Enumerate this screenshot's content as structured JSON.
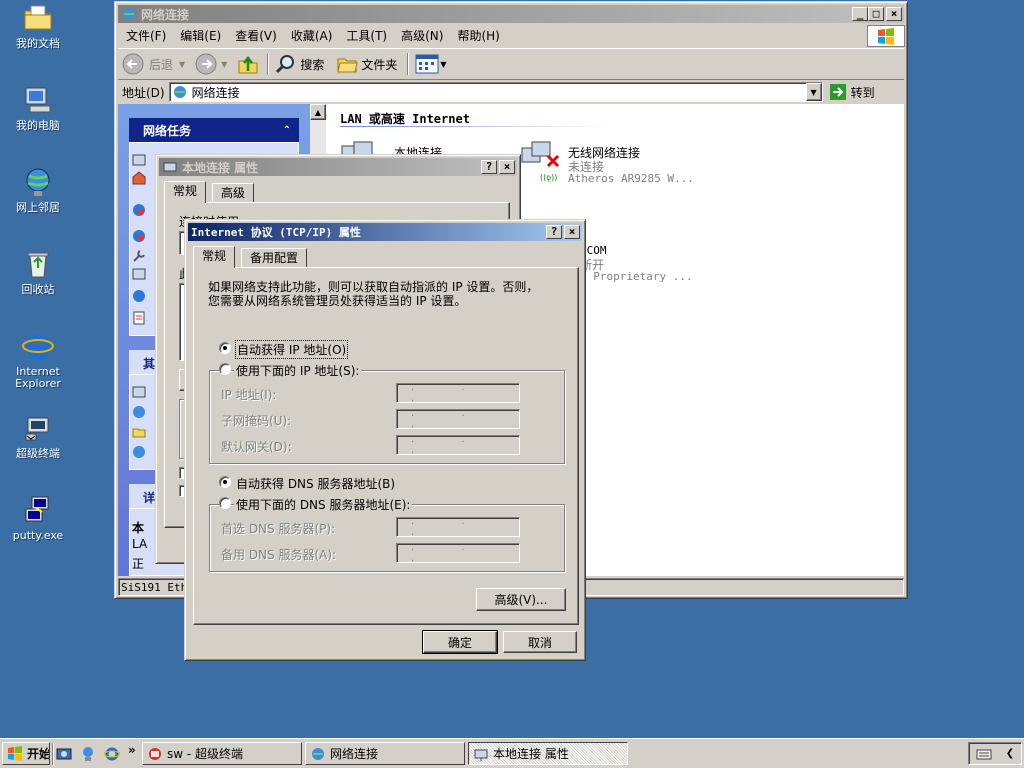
{
  "desktop": {
    "icons": [
      {
        "label": "我的文档"
      },
      {
        "label": "我的电脑"
      },
      {
        "label": "网上邻居"
      },
      {
        "label": "回收站"
      },
      {
        "label": "Internet Explorer"
      },
      {
        "label": "超级终端"
      },
      {
        "label": "putty.exe"
      }
    ]
  },
  "explorer": {
    "title": "网络连接",
    "menu": [
      "文件(F)",
      "编辑(E)",
      "查看(V)",
      "收藏(A)",
      "工具(T)",
      "高级(N)",
      "帮助(H)"
    ],
    "toolbar": {
      "back": "后退",
      "search": "搜索",
      "folders": "文件夹"
    },
    "address_label": "地址(D)",
    "address_value": "网络连接",
    "go_label": "转到",
    "tasks_header": "网络任务",
    "other_header": "其",
    "details_header": "详",
    "details_lines": [
      "本",
      "LA",
      "正"
    ],
    "group_header": "LAN 或高速 Internet",
    "connections": [
      {
        "name": "本地连接",
        "status": "",
        "device": ""
      },
      {
        "name": "无线网络连接",
        "status": "未连接",
        "device": "Atheros AR9285 W..."
      },
      {
        "name": "ICOM",
        "status": "断开",
        "device": "E Proprietary ..."
      }
    ],
    "status_bar": "SiS191 Ethe"
  },
  "local_props": {
    "title": "本地连接 属性",
    "tabs": [
      "常规",
      "高级"
    ],
    "connect_using": "连接时使用:",
    "partial_label": "此"
  },
  "tcpip": {
    "title": "Internet 协议 (TCP/IP) 属性",
    "tabs": [
      "常规",
      "备用配置"
    ],
    "description": "如果网络支持此功能，则可以获取自动指派的 IP 设置。否则，您需要从网络系统管理员处获得适当的 IP 设置。",
    "desc_line1": "如果网络支持此功能，则可以获取自动指派的 IP 设置。否则，",
    "desc_line2": "您需要从网络系统管理员处获得适当的 IP 设置。",
    "auto_ip": "自动获得 IP 地址(O)",
    "manual_ip": "使用下面的 IP 地址(S):",
    "ip_label": "IP 地址(I):",
    "mask_label": "子网掩码(U):",
    "gateway_label": "默认网关(D):",
    "auto_dns": "自动获得 DNS 服务器地址(B)",
    "manual_dns": "使用下面的 DNS 服务器地址(E):",
    "pref_dns_label": "首选 DNS 服务器(P):",
    "alt_dns_label": "备用 DNS 服务器(A):",
    "ip_dots": ". . .",
    "advanced_button": "高级(V)...",
    "ok_button": "确定",
    "cancel_button": "取消",
    "selected_ip_mode": "auto",
    "selected_dns_mode": "auto"
  },
  "taskbar": {
    "start": "开始",
    "tasks": [
      {
        "label": "sw - 超级终端"
      },
      {
        "label": "网络连接"
      },
      {
        "label": "本地连接 属性"
      }
    ]
  }
}
